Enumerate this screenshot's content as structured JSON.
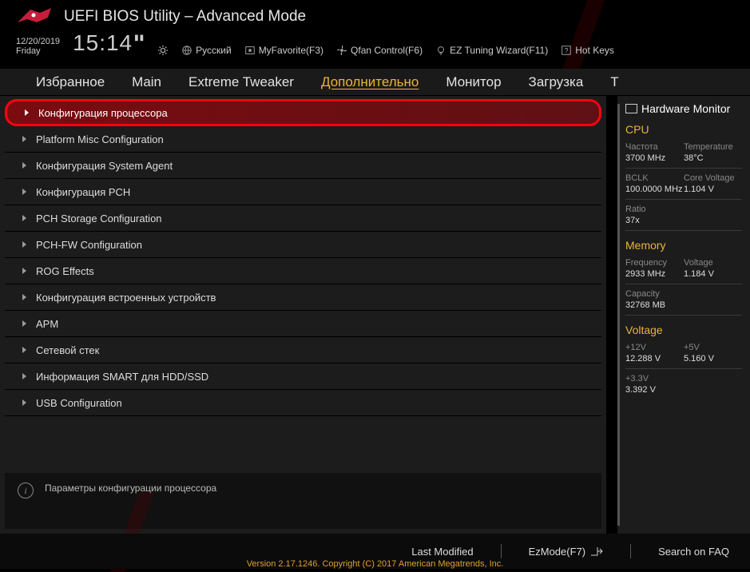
{
  "header": {
    "title": "UEFI BIOS Utility – Advanced Mode",
    "date": "12/20/2019",
    "day": "Friday",
    "time": "15:14",
    "language": "Русский",
    "myfavorite": "MyFavorite(F3)",
    "qfan": "Qfan Control(F6)",
    "wizard": "EZ Tuning Wizard(F11)",
    "hotkeys": "Hot Keys"
  },
  "tabs": [
    "Избранное",
    "Main",
    "Extreme Tweaker",
    "Дополнительно",
    "Монитор",
    "Загрузка",
    "T"
  ],
  "active_tab": 3,
  "menu_items": [
    "Конфигурация процессора",
    "Platform Misc Configuration",
    "Конфигурация System Agent",
    "Конфигурация PCH",
    "PCH Storage Configuration",
    "PCH-FW Configuration",
    "ROG Effects",
    "Конфигурация встроенных устройств",
    "APM",
    "Сетевой стек",
    "Информация SMART для HDD/SSD",
    "USB Configuration"
  ],
  "selected_item": 0,
  "info_text": "Параметры конфигурации процессора",
  "sidebar": {
    "title": "Hardware Monitor",
    "cpu": {
      "title": "CPU",
      "freq_lbl": "Частота",
      "freq_val": "3700 MHz",
      "temp_lbl": "Temperature",
      "temp_val": "38°C",
      "bclk_lbl": "BCLK",
      "bclk_val": "100.0000 MHz",
      "cv_lbl": "Core Voltage",
      "cv_val": "1.104 V",
      "ratio_lbl": "Ratio",
      "ratio_val": "37x"
    },
    "memory": {
      "title": "Memory",
      "freq_lbl": "Frequency",
      "freq_val": "2933 MHz",
      "volt_lbl": "Voltage",
      "volt_val": "1.184 V",
      "cap_lbl": "Capacity",
      "cap_val": "32768 MB"
    },
    "voltage": {
      "title": "Voltage",
      "v12_lbl": "+12V",
      "v12_val": "12.288 V",
      "v5_lbl": "+5V",
      "v5_val": "5.160 V",
      "v33_lbl": "+3.3V",
      "v33_val": "3.392 V"
    }
  },
  "footer": {
    "last_modified": "Last Modified",
    "ezmode": "EzMode(F7)",
    "search": "Search on FAQ",
    "version": "Version 2.17.1246. Copyright (C) 2017 American Megatrends, Inc."
  }
}
